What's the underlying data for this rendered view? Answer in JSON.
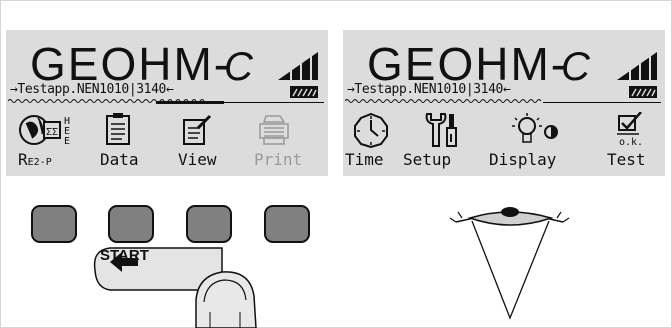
{
  "panels": [
    {
      "brand": "GEOHM-",
      "brand_suffix": "C",
      "status_line": "→Testapp.NEN1010|3140←",
      "menu": [
        {
          "label": "R",
          "label_sub": "E2-P",
          "icon": "earth-plug-icon",
          "dimmed": false
        },
        {
          "label": "Data",
          "icon": "clipboard-icon",
          "dimmed": false
        },
        {
          "label": "View",
          "icon": "document-pencil-icon",
          "dimmed": false
        },
        {
          "label": "Print",
          "icon": "printer-icon",
          "dimmed": true
        }
      ]
    },
    {
      "brand": "GEOHM-",
      "brand_suffix": "C",
      "status_line": "→Testapp.NEN1010|3140←",
      "menu": [
        {
          "label": "Time",
          "icon": "clock-icon",
          "dimmed": false
        },
        {
          "label": "Setup",
          "icon": "tools-icon",
          "dimmed": false
        },
        {
          "label": "Display",
          "icon": "lightbulb-contrast-icon",
          "dimmed": false
        },
        {
          "label": "Test",
          "icon": "checkbox-ok-icon",
          "dimmed": false,
          "icon_caption": "o.k."
        }
      ]
    }
  ],
  "keypad": {
    "buttons": 4
  },
  "start_tag": {
    "label": "START",
    "icon": "arrow-left-icon"
  },
  "hints": {
    "hand": "finger-press-icon",
    "eye": "eye-icon"
  }
}
